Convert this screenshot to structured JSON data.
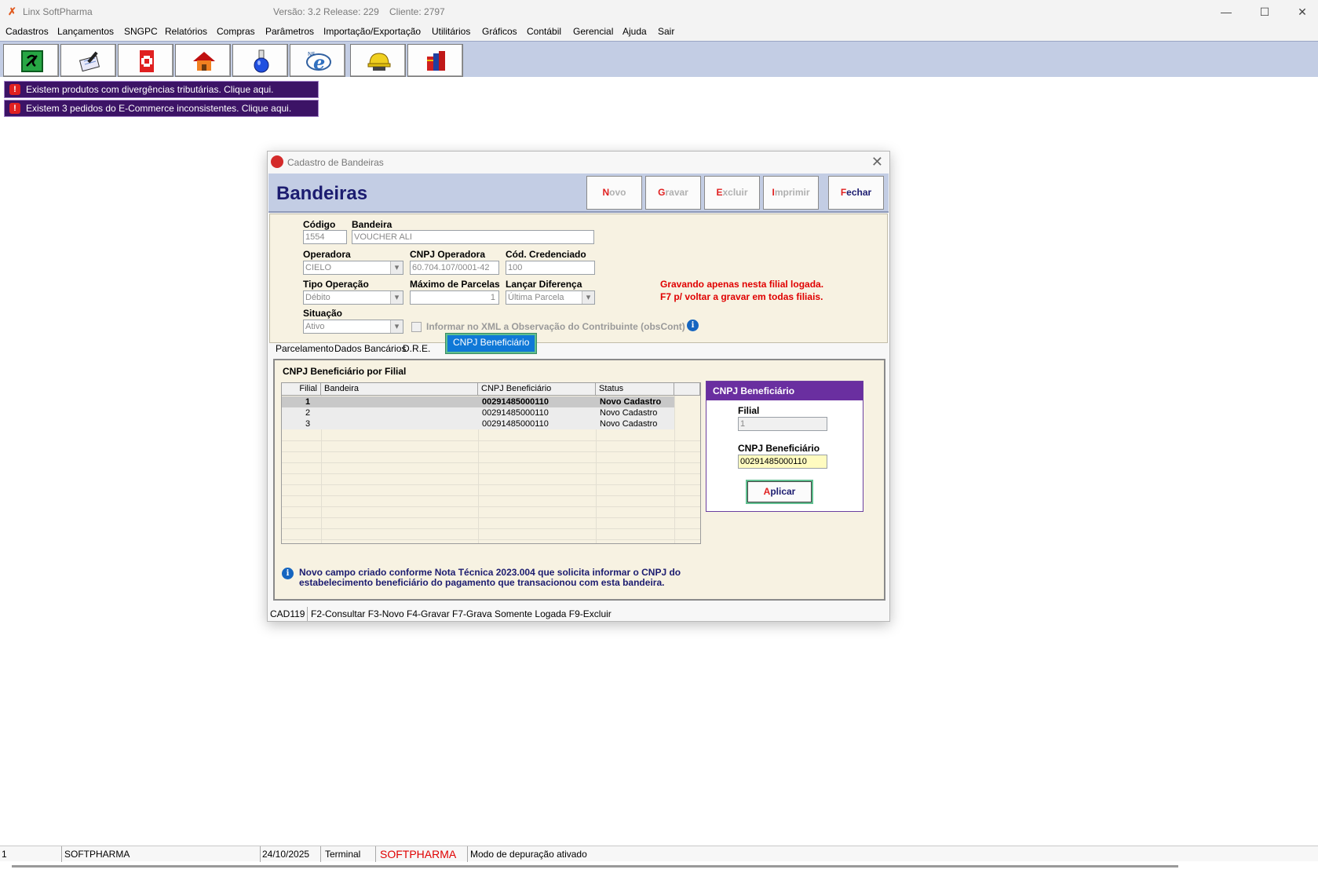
{
  "window": {
    "app_title": "Linx SoftPharma",
    "version": "Versão: 3.2 Release: 229",
    "client": "Cliente: 2797"
  },
  "menu": [
    "Cadastros",
    "Lançamentos",
    "SNGPC",
    "Relatórios",
    "Compras",
    "Parâmetros",
    "Importação/Exportação",
    "Utilitários",
    "Gráficos",
    "Contábil",
    "Gerencial",
    "Ajuda",
    "Sair"
  ],
  "toolbar_icons": [
    "cash-register-icon",
    "notepad-pen-icon",
    "pharmacy-cross-icon",
    "house-icon",
    "flask-icon",
    "nfe-icon",
    "safety-helmet-icon",
    "books-icon"
  ],
  "alerts": [
    "Existem produtos com divergências tributárias. Clique aqui.",
    "Existem 3 pedidos do E-Commerce inconsistentes. Clique aqui."
  ],
  "dialog": {
    "title": "Cadastro de Bandeiras",
    "heading": "Bandeiras",
    "buttons": {
      "novo": {
        "first": "N",
        "rest": "ovo"
      },
      "gravar": {
        "first": "G",
        "rest": "ravar"
      },
      "excluir": {
        "first": "E",
        "rest": "xcluir"
      },
      "imprimir": {
        "first": "I",
        "rest": "mprimir"
      },
      "fechar": {
        "first": "F",
        "rest": "echar"
      }
    },
    "form": {
      "codigo_label": "Código",
      "codigo": "1554",
      "bandeira_label": "Bandeira",
      "bandeira": "VOUCHER ALI",
      "operadora_label": "Operadora",
      "operadora": "CIELO",
      "cnpj_operadora_label": "CNPJ Operadora",
      "cnpj_operadora": "60.704.107/0001-42",
      "cod_credenciado_label": "Cód. Credenciado",
      "cod_credenciado": "100",
      "tipo_operacao_label": "Tipo Operação",
      "tipo_operacao": "Débito",
      "max_parcelas_label": "Máximo de Parcelas",
      "max_parcelas": "1",
      "lancar_diferenca_label": "Lançar Diferença",
      "lancar_diferenca": "Última Parcela",
      "situacao_label": "Situação",
      "situacao": "Ativo",
      "xml_checkbox_label": "Informar no XML a Observação do Contribuinte (obsCont)",
      "warning_line1": "Gravando apenas nesta filial logada.",
      "warning_line2": "F7 p/ voltar a gravar em todas filiais."
    },
    "tabs": [
      "Parcelamento",
      "Dados Bancários",
      "D.R.E.",
      "CNPJ Beneficiário"
    ],
    "panel": {
      "title": "CNPJ Beneficiário por Filial",
      "columns": [
        "Filial",
        "Bandeira",
        "CNPJ Beneficiário",
        "Status"
      ],
      "rows": [
        {
          "filial": "1",
          "bandeira": "",
          "cnpj": "00291485000110",
          "status": "Novo Cadastro"
        },
        {
          "filial": "2",
          "bandeira": "",
          "cnpj": "00291485000110",
          "status": "Novo Cadastro"
        },
        {
          "filial": "3",
          "bandeira": "",
          "cnpj": "00291485000110",
          "status": "Novo Cadastro"
        }
      ],
      "side": {
        "title": "CNPJ Beneficiário",
        "filial_label": "Filial",
        "filial": "1",
        "cnpj_label": "CNPJ Beneficiário",
        "cnpj": "00291485000110",
        "apply_first": "A",
        "apply_rest": "plicar"
      },
      "note_line1": "Novo campo criado conforme Nota Técnica 2023.004 que solicita informar o CNPJ do",
      "note_line2": "estabelecimento beneficiário do pagamento que transacionou com esta bandeira."
    },
    "status": "CAD119 | F2-Consultar  F3-Novo  F4-Gravar  F7-Grava Somente Logada  F9-Excluir",
    "status_code": "CAD119",
    "status_keys": "F2-Consultar  F3-Novo  F4-Gravar  F7-Grava Somente Logada  F9-Excluir"
  },
  "statusbar": {
    "field1": "1",
    "user": "SOFTPHARMA",
    "date": "24/10/2025",
    "terminal": "Terminal",
    "brand": "SOFTPHARMA",
    "debug": "Modo de depuração ativado"
  },
  "colors": {
    "toolbar": "#c3cde4",
    "alert_bg": "#3c1366",
    "side_header": "#6a2fa0",
    "tab_selected": "#0f78d7",
    "warning": "#e00000"
  }
}
